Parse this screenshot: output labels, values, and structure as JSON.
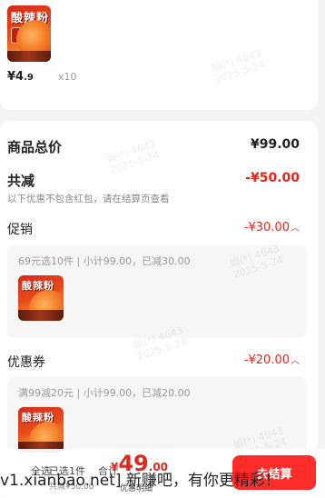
{
  "top_item": {
    "thumb_title": "酸辣粉",
    "price_main": "¥4",
    "price_dec": ".9",
    "quantity": "x10"
  },
  "summary": {
    "goods_total_label": "商品总价",
    "goods_total_value": "¥99.00",
    "total_discount_label": "共减",
    "total_discount_value": "-¥50.00",
    "note": "以下优惠不包含红包，请在结算页查看"
  },
  "promotion": {
    "label": "促销",
    "value": "-¥30.00",
    "desc": "69元选10件 | 小计99.00，已减30.00",
    "thumb_title": "酸辣粉"
  },
  "coupon": {
    "label": "优惠券",
    "value": "-¥20.00",
    "desc": "满99减20元 | 小计99.00，已减20.00",
    "thumb_title": "酸辣粉"
  },
  "watermark": {
    "line1": "娟(*) 4643",
    "line2": "2025-5-24"
  },
  "bottom_bar": {
    "select_all": "全选",
    "selected_count": "已选1件",
    "total_label": "合计",
    "total_currency": "¥",
    "total_int": "49",
    "total_dec": ".00",
    "saved": "共减¥50.00",
    "detail": "优惠明细",
    "checkout": "去结算"
  },
  "overlay": {
    "text": "v1.xianbao.net] 新赚吧，有你更精彩！"
  },
  "colors": {
    "accent_red": "#e0281e",
    "button_red": "#ff2c2c"
  }
}
